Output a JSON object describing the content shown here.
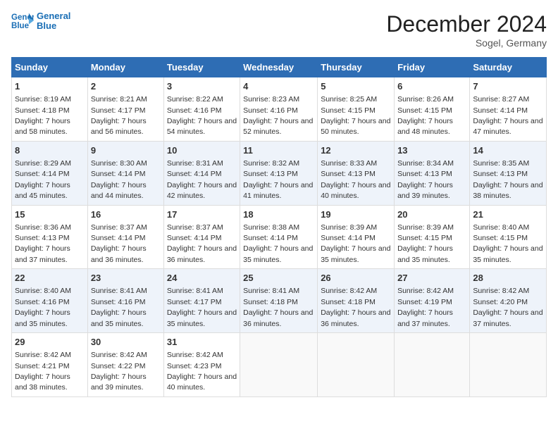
{
  "logo": {
    "text1": "General",
    "text2": "Blue"
  },
  "header": {
    "month": "December 2024",
    "location": "Sogel, Germany"
  },
  "weekdays": [
    "Sunday",
    "Monday",
    "Tuesday",
    "Wednesday",
    "Thursday",
    "Friday",
    "Saturday"
  ],
  "weeks": [
    [
      {
        "day": "1",
        "sunrise": "8:19 AM",
        "sunset": "4:18 PM",
        "daylight": "7 hours and 58 minutes."
      },
      {
        "day": "2",
        "sunrise": "8:21 AM",
        "sunset": "4:17 PM",
        "daylight": "7 hours and 56 minutes."
      },
      {
        "day": "3",
        "sunrise": "8:22 AM",
        "sunset": "4:16 PM",
        "daylight": "7 hours and 54 minutes."
      },
      {
        "day": "4",
        "sunrise": "8:23 AM",
        "sunset": "4:16 PM",
        "daylight": "7 hours and 52 minutes."
      },
      {
        "day": "5",
        "sunrise": "8:25 AM",
        "sunset": "4:15 PM",
        "daylight": "7 hours and 50 minutes."
      },
      {
        "day": "6",
        "sunrise": "8:26 AM",
        "sunset": "4:15 PM",
        "daylight": "7 hours and 48 minutes."
      },
      {
        "day": "7",
        "sunrise": "8:27 AM",
        "sunset": "4:14 PM",
        "daylight": "7 hours and 47 minutes."
      }
    ],
    [
      {
        "day": "8",
        "sunrise": "8:29 AM",
        "sunset": "4:14 PM",
        "daylight": "7 hours and 45 minutes."
      },
      {
        "day": "9",
        "sunrise": "8:30 AM",
        "sunset": "4:14 PM",
        "daylight": "7 hours and 44 minutes."
      },
      {
        "day": "10",
        "sunrise": "8:31 AM",
        "sunset": "4:14 PM",
        "daylight": "7 hours and 42 minutes."
      },
      {
        "day": "11",
        "sunrise": "8:32 AM",
        "sunset": "4:13 PM",
        "daylight": "7 hours and 41 minutes."
      },
      {
        "day": "12",
        "sunrise": "8:33 AM",
        "sunset": "4:13 PM",
        "daylight": "7 hours and 40 minutes."
      },
      {
        "day": "13",
        "sunrise": "8:34 AM",
        "sunset": "4:13 PM",
        "daylight": "7 hours and 39 minutes."
      },
      {
        "day": "14",
        "sunrise": "8:35 AM",
        "sunset": "4:13 PM",
        "daylight": "7 hours and 38 minutes."
      }
    ],
    [
      {
        "day": "15",
        "sunrise": "8:36 AM",
        "sunset": "4:13 PM",
        "daylight": "7 hours and 37 minutes."
      },
      {
        "day": "16",
        "sunrise": "8:37 AM",
        "sunset": "4:14 PM",
        "daylight": "7 hours and 36 minutes."
      },
      {
        "day": "17",
        "sunrise": "8:37 AM",
        "sunset": "4:14 PM",
        "daylight": "7 hours and 36 minutes."
      },
      {
        "day": "18",
        "sunrise": "8:38 AM",
        "sunset": "4:14 PM",
        "daylight": "7 hours and 35 minutes."
      },
      {
        "day": "19",
        "sunrise": "8:39 AM",
        "sunset": "4:14 PM",
        "daylight": "7 hours and 35 minutes."
      },
      {
        "day": "20",
        "sunrise": "8:39 AM",
        "sunset": "4:15 PM",
        "daylight": "7 hours and 35 minutes."
      },
      {
        "day": "21",
        "sunrise": "8:40 AM",
        "sunset": "4:15 PM",
        "daylight": "7 hours and 35 minutes."
      }
    ],
    [
      {
        "day": "22",
        "sunrise": "8:40 AM",
        "sunset": "4:16 PM",
        "daylight": "7 hours and 35 minutes."
      },
      {
        "day": "23",
        "sunrise": "8:41 AM",
        "sunset": "4:16 PM",
        "daylight": "7 hours and 35 minutes."
      },
      {
        "day": "24",
        "sunrise": "8:41 AM",
        "sunset": "4:17 PM",
        "daylight": "7 hours and 35 minutes."
      },
      {
        "day": "25",
        "sunrise": "8:41 AM",
        "sunset": "4:18 PM",
        "daylight": "7 hours and 36 minutes."
      },
      {
        "day": "26",
        "sunrise": "8:42 AM",
        "sunset": "4:18 PM",
        "daylight": "7 hours and 36 minutes."
      },
      {
        "day": "27",
        "sunrise": "8:42 AM",
        "sunset": "4:19 PM",
        "daylight": "7 hours and 37 minutes."
      },
      {
        "day": "28",
        "sunrise": "8:42 AM",
        "sunset": "4:20 PM",
        "daylight": "7 hours and 37 minutes."
      }
    ],
    [
      {
        "day": "29",
        "sunrise": "8:42 AM",
        "sunset": "4:21 PM",
        "daylight": "7 hours and 38 minutes."
      },
      {
        "day": "30",
        "sunrise": "8:42 AM",
        "sunset": "4:22 PM",
        "daylight": "7 hours and 39 minutes."
      },
      {
        "day": "31",
        "sunrise": "8:42 AM",
        "sunset": "4:23 PM",
        "daylight": "7 hours and 40 minutes."
      },
      null,
      null,
      null,
      null
    ]
  ]
}
